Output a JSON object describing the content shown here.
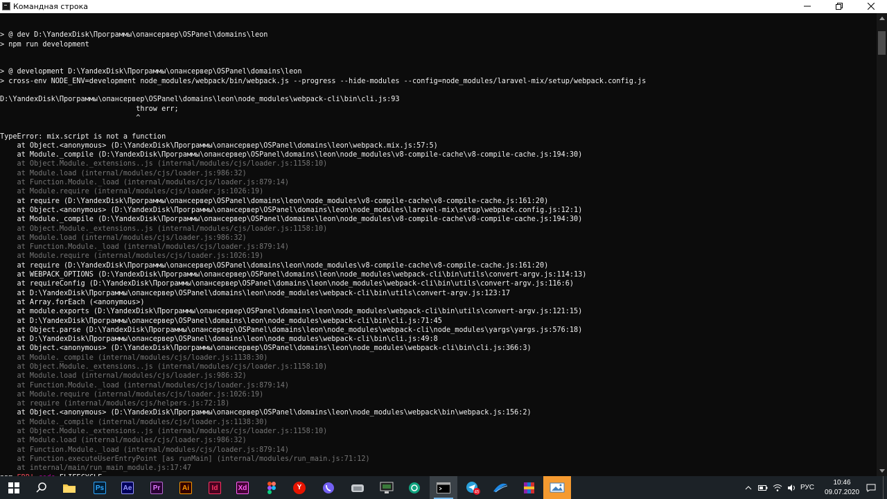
{
  "window": {
    "title": "Командная строка",
    "controls": {
      "minimize": "—",
      "maximize": "❐",
      "close": "✕"
    }
  },
  "console": {
    "lines": [
      {
        "t": "",
        "s": "normal"
      },
      {
        "t": "> @ dev D:\\YandexDisk\\Программы\\опансервер\\OSPanel\\domains\\leon",
        "s": "bright"
      },
      {
        "t": "> npm run development",
        "s": "bright"
      },
      {
        "t": "",
        "s": "normal"
      },
      {
        "t": "",
        "s": "normal"
      },
      {
        "t": "> @ development D:\\YandexDisk\\Программы\\опансервер\\OSPanel\\domains\\leon",
        "s": "bright"
      },
      {
        "t": "> cross-env NODE_ENV=development node_modules/webpack/bin/webpack.js --progress --hide-modules --config=node_modules/laravel-mix/setup/webpack.config.js",
        "s": "bright"
      },
      {
        "t": "",
        "s": "normal"
      },
      {
        "t": "D:\\YandexDisk\\Программы\\опансервер\\OSPanel\\domains\\leon\\node_modules\\webpack-cli\\bin\\cli.js:93",
        "s": "bright"
      },
      {
        "t": "                                throw err;",
        "s": "bright"
      },
      {
        "t": "                                ^",
        "s": "bright"
      },
      {
        "t": "",
        "s": "normal"
      },
      {
        "t": "TypeError: mix.script is not a function",
        "s": "bright"
      },
      {
        "t": "    at Object.<anonymous> (D:\\YandexDisk\\Программы\\опансервер\\OSPanel\\domains\\leon\\webpack.mix.js:57:5)",
        "s": "bright"
      },
      {
        "t": "    at Module._compile (D:\\YandexDisk\\Программы\\опансервер\\OSPanel\\domains\\leon\\node_modules\\v8-compile-cache\\v8-compile-cache.js:194:30)",
        "s": "bright"
      },
      {
        "t": "    at Object.Module._extensions..js (internal/modules/cjs/loader.js:1158:10)",
        "s": "dim"
      },
      {
        "t": "    at Module.load (internal/modules/cjs/loader.js:986:32)",
        "s": "dim"
      },
      {
        "t": "    at Function.Module._load (internal/modules/cjs/loader.js:879:14)",
        "s": "dim"
      },
      {
        "t": "    at Module.require (internal/modules/cjs/loader.js:1026:19)",
        "s": "dim"
      },
      {
        "t": "    at require (D:\\YandexDisk\\Программы\\опансервер\\OSPanel\\domains\\leon\\node_modules\\v8-compile-cache\\v8-compile-cache.js:161:20)",
        "s": "bright"
      },
      {
        "t": "    at Object.<anonymous> (D:\\YandexDisk\\Программы\\опансервер\\OSPanel\\domains\\leon\\node_modules\\laravel-mix\\setup\\webpack.config.js:12:1)",
        "s": "bright"
      },
      {
        "t": "    at Module._compile (D:\\YandexDisk\\Программы\\опансервер\\OSPanel\\domains\\leon\\node_modules\\v8-compile-cache\\v8-compile-cache.js:194:30)",
        "s": "bright"
      },
      {
        "t": "    at Object.Module._extensions..js (internal/modules/cjs/loader.js:1158:10)",
        "s": "dim"
      },
      {
        "t": "    at Module.load (internal/modules/cjs/loader.js:986:32)",
        "s": "dim"
      },
      {
        "t": "    at Function.Module._load (internal/modules/cjs/loader.js:879:14)",
        "s": "dim"
      },
      {
        "t": "    at Module.require (internal/modules/cjs/loader.js:1026:19)",
        "s": "dim"
      },
      {
        "t": "    at require (D:\\YandexDisk\\Программы\\опансервер\\OSPanel\\domains\\leon\\node_modules\\v8-compile-cache\\v8-compile-cache.js:161:20)",
        "s": "bright"
      },
      {
        "t": "    at WEBPACK_OPTIONS (D:\\YandexDisk\\Программы\\опансервер\\OSPanel\\domains\\leon\\node_modules\\webpack-cli\\bin\\utils\\convert-argv.js:114:13)",
        "s": "bright"
      },
      {
        "t": "    at requireConfig (D:\\YandexDisk\\Программы\\опансервер\\OSPanel\\domains\\leon\\node_modules\\webpack-cli\\bin\\utils\\convert-argv.js:116:6)",
        "s": "bright"
      },
      {
        "t": "    at D:\\YandexDisk\\Программы\\опансервер\\OSPanel\\domains\\leon\\node_modules\\webpack-cli\\bin\\utils\\convert-argv.js:123:17",
        "s": "bright"
      },
      {
        "t": "    at Array.forEach (<anonymous>)",
        "s": "bright"
      },
      {
        "t": "    at module.exports (D:\\YandexDisk\\Программы\\опансервер\\OSPanel\\domains\\leon\\node_modules\\webpack-cli\\bin\\utils\\convert-argv.js:121:15)",
        "s": "bright"
      },
      {
        "t": "    at D:\\YandexDisk\\Программы\\опансервер\\OSPanel\\domains\\leon\\node_modules\\webpack-cli\\bin\\cli.js:71:45",
        "s": "bright"
      },
      {
        "t": "    at Object.parse (D:\\YandexDisk\\Программы\\опансервер\\OSPanel\\domains\\leon\\node_modules\\webpack-cli\\node_modules\\yargs\\yargs.js:576:18)",
        "s": "bright"
      },
      {
        "t": "    at D:\\YandexDisk\\Программы\\опансервер\\OSPanel\\domains\\leon\\node_modules\\webpack-cli\\bin\\cli.js:49:8",
        "s": "bright"
      },
      {
        "t": "    at Object.<anonymous> (D:\\YandexDisk\\Программы\\опансервер\\OSPanel\\domains\\leon\\node_modules\\webpack-cli\\bin\\cli.js:366:3)",
        "s": "bright"
      },
      {
        "t": "    at Module._compile (internal/modules/cjs/loader.js:1138:30)",
        "s": "dim"
      },
      {
        "t": "    at Object.Module._extensions..js (internal/modules/cjs/loader.js:1158:10)",
        "s": "dim"
      },
      {
        "t": "    at Module.load (internal/modules/cjs/loader.js:986:32)",
        "s": "dim"
      },
      {
        "t": "    at Function.Module._load (internal/modules/cjs/loader.js:879:14)",
        "s": "dim"
      },
      {
        "t": "    at Module.require (internal/modules/cjs/loader.js:1026:19)",
        "s": "dim"
      },
      {
        "t": "    at require (internal/modules/cjs/helpers.js:72:18)",
        "s": "dim"
      },
      {
        "t": "    at Object.<anonymous> (D:\\YandexDisk\\Программы\\опансервер\\OSPanel\\domains\\leon\\node_modules\\webpack\\bin\\webpack.js:156:2)",
        "s": "bright"
      },
      {
        "t": "    at Module._compile (internal/modules/cjs/loader.js:1138:30)",
        "s": "dim"
      },
      {
        "t": "    at Object.Module._extensions..js (internal/modules/cjs/loader.js:1158:10)",
        "s": "dim"
      },
      {
        "t": "    at Module.load (internal/modules/cjs/loader.js:986:32)",
        "s": "dim"
      },
      {
        "t": "    at Function.Module._load (internal/modules/cjs/loader.js:879:14)",
        "s": "dim"
      },
      {
        "t": "    at Function.executeUserEntryPoint [as runMain] (internal/modules/run_main.js:71:12)",
        "s": "dim"
      },
      {
        "t": "    at internal/main/run_main_module.js:17:47",
        "s": "dim"
      }
    ],
    "last_line": {
      "prefix": "npm ",
      "err": "ERR!",
      "code": " code",
      "rest": " ELIFECYCLE"
    }
  },
  "taskbar": {
    "apps": [
      {
        "name": "start-button",
        "label": "",
        "icon": "windows-logo-icon"
      },
      {
        "name": "search-button",
        "label": "",
        "icon": "search-icon"
      },
      {
        "name": "file-explorer",
        "label": "",
        "icon": "folder-icon"
      },
      {
        "name": "photoshop",
        "label": "Ps",
        "color": "#31a8ff",
        "bg": "#001e36"
      },
      {
        "name": "after-effects",
        "label": "Ae",
        "color": "#9999ff",
        "bg": "#00005b"
      },
      {
        "name": "premiere",
        "label": "Pr",
        "color": "#9999ff",
        "bg": "#00005b"
      },
      {
        "name": "illustrator",
        "label": "Ai",
        "color": "#ff9a00",
        "bg": "#330000"
      },
      {
        "name": "indesign",
        "label": "Id",
        "color": "#ff3366",
        "bg": "#49021f"
      },
      {
        "name": "xd",
        "label": "Xd",
        "color": "#ff61f6",
        "bg": "#470137"
      },
      {
        "name": "figma",
        "label": "",
        "icon": "figma-icon"
      },
      {
        "name": "yandex-browser",
        "label": "Y",
        "color": "#ffffff",
        "bg": "#e61400"
      },
      {
        "name": "viber",
        "label": "",
        "icon": "viber-icon"
      },
      {
        "name": "app-cloud",
        "label": "",
        "icon": "cloud-icon"
      },
      {
        "name": "app-monitor",
        "label": "",
        "icon": "monitor-icon"
      },
      {
        "name": "app-chatgpt",
        "label": "",
        "icon": "openai-icon"
      },
      {
        "name": "command-prompt",
        "label": "",
        "icon": "cmd-icon",
        "active": true
      },
      {
        "name": "telegram",
        "label": "",
        "icon": "telegram-icon",
        "badge": "45"
      },
      {
        "name": "app-blue-wave",
        "label": "",
        "icon": "wave-icon"
      },
      {
        "name": "winrar",
        "label": "",
        "icon": "archive-icon"
      },
      {
        "name": "app-highlight",
        "label": "",
        "icon": "image-icon",
        "highlight": true
      }
    ],
    "tray": {
      "language": "РУС",
      "time": "10:46",
      "date": "09.07.2020"
    }
  },
  "colors": {
    "console_bg": "#0c0c0c",
    "text": "#cccccc",
    "dim": "#767676",
    "err": "#e74856",
    "code": "#b4009e",
    "taskbar": "#1c2227"
  }
}
